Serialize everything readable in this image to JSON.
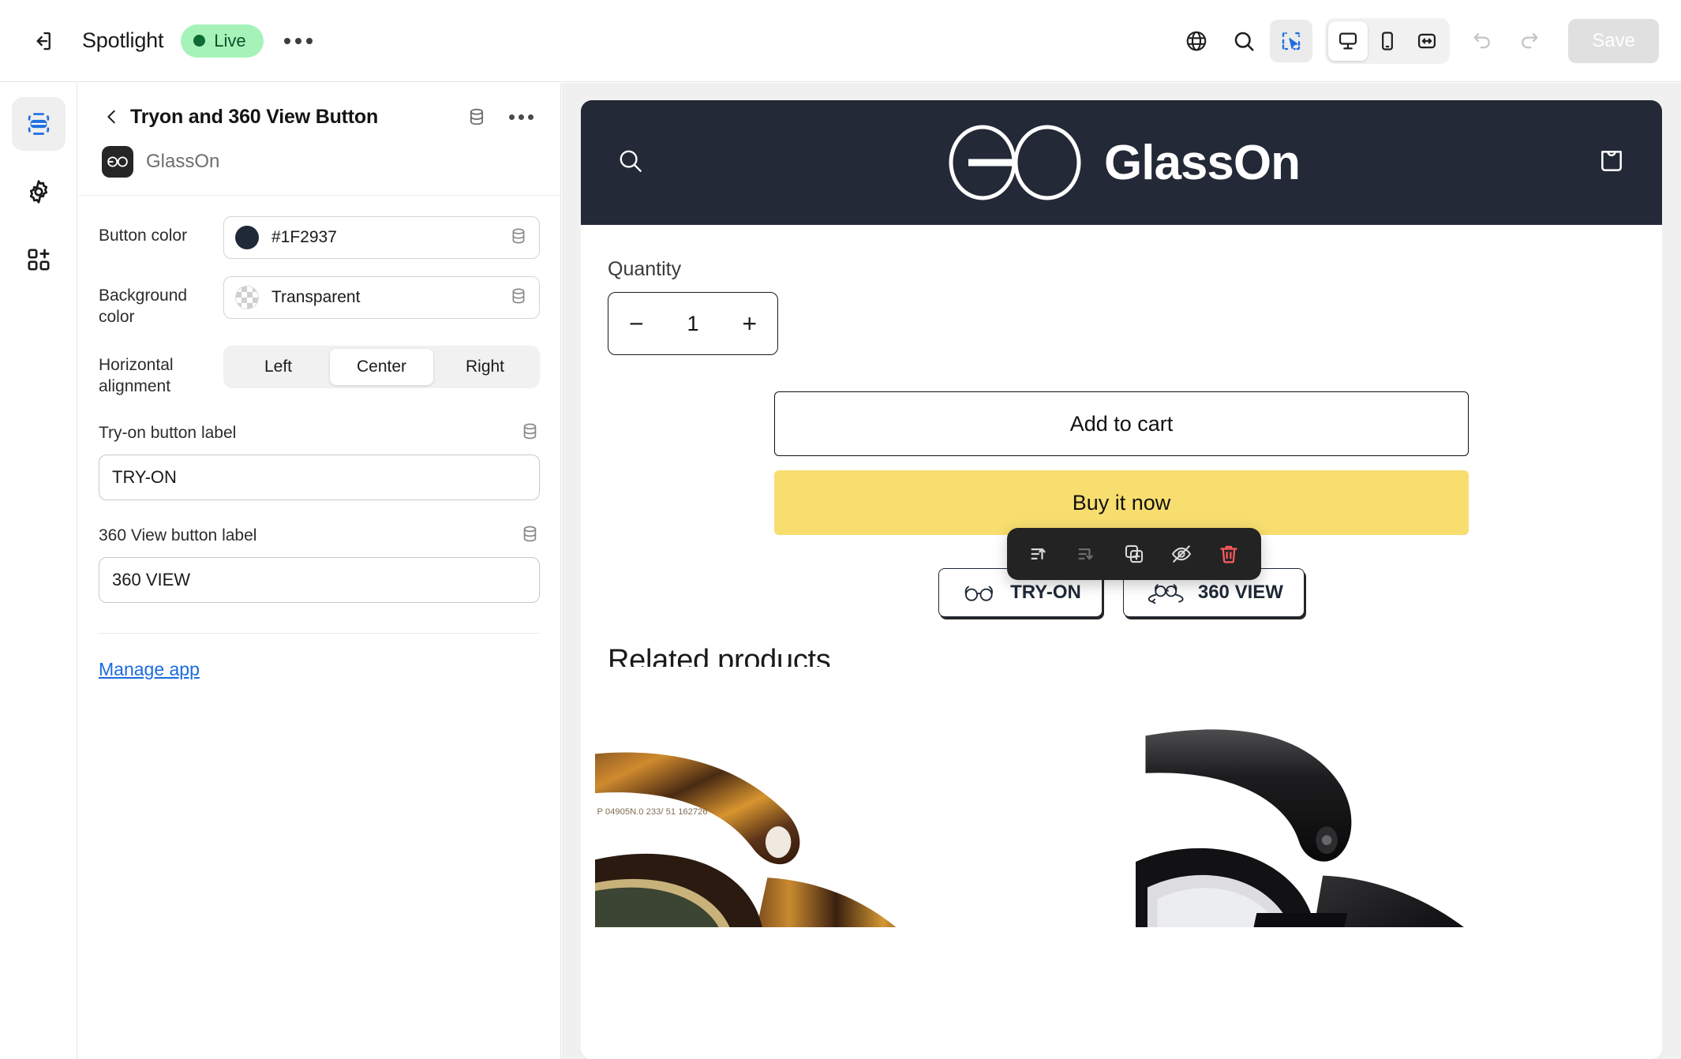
{
  "topbar": {
    "exit_icon": "exit-icon",
    "title": "Spotlight",
    "status_badge": "Live",
    "more_icon": "ellipsis-icon",
    "globe_icon": "globe-icon",
    "search_icon": "search-icon",
    "select_icon": "inspector-select-icon",
    "desktop_icon": "desktop-icon",
    "mobile_icon": "mobile-icon",
    "fullwidth_icon": "full-width-icon",
    "undo_icon": "undo-icon",
    "redo_icon": "redo-icon",
    "save_label": "Save"
  },
  "rail": {
    "items": [
      {
        "name": "sections",
        "icon": "sections-icon",
        "active": true
      },
      {
        "name": "settings",
        "icon": "gear-icon",
        "active": false
      },
      {
        "name": "apps",
        "icon": "add-blocks-icon",
        "active": false
      }
    ]
  },
  "panel": {
    "back_icon": "chevron-left-icon",
    "title": "Tryon and 360 View Button",
    "db_icon": "database-icon",
    "more_icon": "ellipsis-icon",
    "app_badge": "GO",
    "app_name": "GlassOn",
    "fields": {
      "button_color_label": "Button color",
      "button_color_value": "#1F2937",
      "button_color_hex": "#1F2937",
      "background_color_label": "Background color",
      "background_color_value": "Transparent",
      "alignment_label": "Horizontal alignment",
      "alignment_options": [
        "Left",
        "Center",
        "Right"
      ],
      "alignment_selected": "Center",
      "tryon_label": "Try-on button label",
      "tryon_value": "TRY-ON",
      "view360_label": "360 View button label",
      "view360_value": "360 VIEW"
    },
    "manage_link": "Manage app"
  },
  "preview": {
    "store_header": {
      "search_icon": "search-icon",
      "logo_mark": "glasses-logo-icon",
      "logo_text": "GlassOn",
      "cart_icon": "shopping-bag-icon",
      "bg_color": "#232936"
    },
    "product": {
      "quantity_label": "Quantity",
      "quantity_value": "1",
      "decrement_label": "−",
      "increment_label": "+",
      "add_to_cart_label": "Add to cart",
      "buy_now_label": "Buy it now",
      "buy_now_color": "#F7DE6F",
      "tryon_button_label": "TRY-ON",
      "tryon_button_icon": "glasses-icon",
      "view360_button_label": "360 VIEW",
      "view360_button_icon": "glasses-rotate-icon",
      "related_title": "Related products"
    },
    "block_toolbar": {
      "move_up_icon": "move-up-icon",
      "move_down_icon": "move-down-icon",
      "duplicate_icon": "duplicate-icon",
      "hide_icon": "eye-off-icon",
      "delete_icon": "trash-icon",
      "delete_color": "#FF5C5C"
    },
    "related_products": [
      {
        "name": "tortoiseshell-glasses",
        "alt": "Tortoiseshell frame glasses"
      },
      {
        "name": "black-glasses",
        "alt": "Black frame glasses"
      }
    ]
  }
}
